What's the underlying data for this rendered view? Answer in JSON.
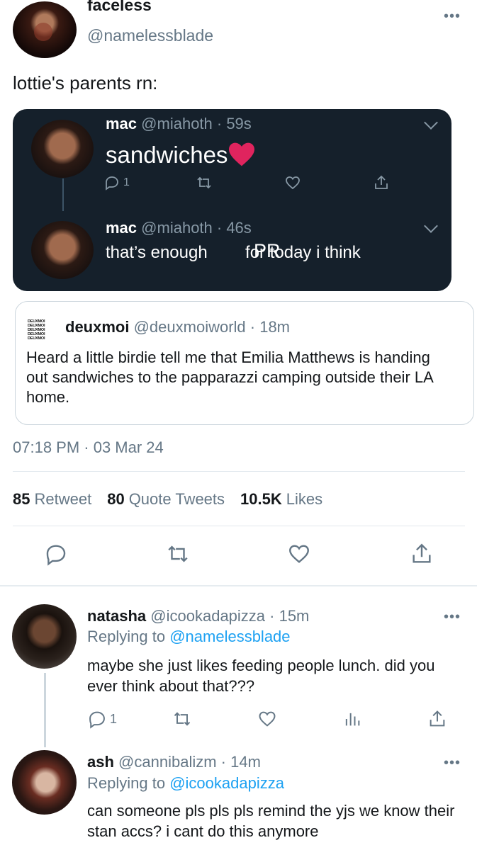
{
  "main_tweet": {
    "author_name": "faceless",
    "author_handle": "@namelessblade",
    "text": "lottie's parents rn:",
    "more": "•••",
    "image": {
      "tweet1": {
        "name": "mac",
        "handle_time": "@miahoth · 59s",
        "text": "sandwiches",
        "reply_count": "1"
      },
      "tweet2": {
        "name": "mac",
        "handle_time": "@miahoth · 46s",
        "text": "that’s enough        for today i think",
        "overlay": "PR"
      }
    },
    "quoted": {
      "logo_text": "DEUXMOI DEUXMOI DEUXMOI DEUXMOI DEUXMOI",
      "name": "deuxmoi",
      "handle_time": "@deuxmoiworld · 18m",
      "text": "Heard a little birdie tell me that Emilia Matthews is handing out sandwiches to the papparazzi camping outside their LA home."
    },
    "timestamp": "07:18 PM · 03 Mar 24",
    "stats": {
      "retweets": "85",
      "retweets_label": "Retweet",
      "quotes": "80",
      "quotes_label": "Quote Tweets",
      "likes": "10.5K",
      "likes_label": "Likes"
    }
  },
  "replies": [
    {
      "name": "natasha",
      "handle_time": "@icookadapizza · 15m",
      "replying_prefix": "Replying to",
      "replying_to": "@namelessblade",
      "text": "maybe she just likes feeding people lunch. did you ever think about that???",
      "reply_count": "1",
      "more": "•••"
    },
    {
      "name": "ash",
      "handle_time": "@cannibalizm · 14m",
      "replying_prefix": "Replying to",
      "replying_to": "@icookadapizza",
      "text": "can someone pls pls pls remind the yjs we know their stan accs? i cant do this anymore",
      "more": "•••"
    }
  ],
  "colors": {
    "accent": "#1da1f2",
    "muted": "#657786",
    "embed_bg": "#15202b",
    "heart": "#e0245e"
  }
}
